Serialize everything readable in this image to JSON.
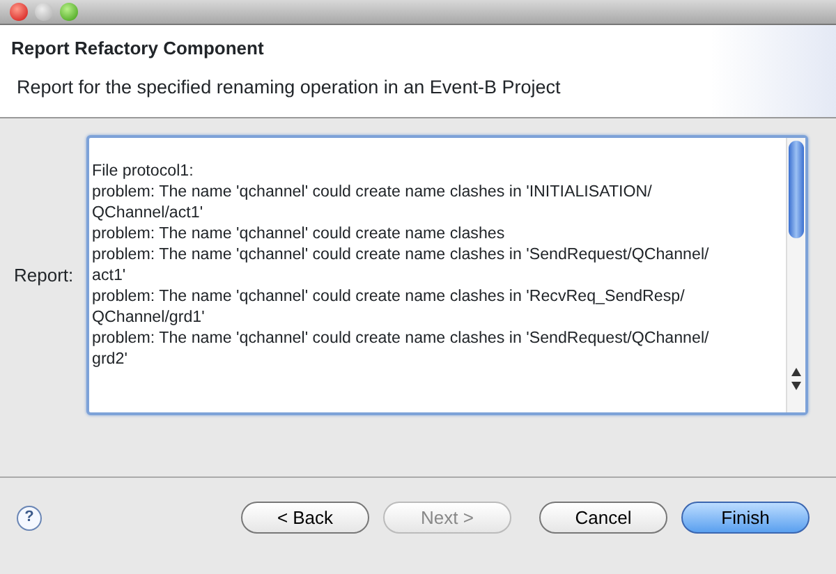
{
  "window": {
    "title_buttons": [
      {
        "kind": "close"
      },
      {
        "kind": "minimize"
      },
      {
        "kind": "zoom"
      }
    ]
  },
  "header": {
    "title": "Report Refactory Component",
    "description": "Report for the specified renaming operation in an Event-B Project"
  },
  "report": {
    "label": "Report:",
    "lines": [
      "File protocol1:",
      "problem: The name 'qchannel' could create name clashes in 'INITIALISATION/",
      "QChannel/act1'",
      "problem: The name 'qchannel' could create name clashes",
      "problem: The name 'qchannel' could create name clashes in 'SendRequest/QChannel/",
      "act1'",
      "problem: The name 'qchannel' could create name clashes in 'RecvReq_SendResp/",
      "QChannel/grd1'",
      "problem: The name 'qchannel' could create name clashes in 'SendRequest/QChannel/",
      "grd2'"
    ]
  },
  "help": "?",
  "buttons": [
    {
      "label": "< Back",
      "disabled": false,
      "default": false
    },
    {
      "label": "Next >",
      "disabled": true,
      "default": false
    },
    {
      "label": "Cancel",
      "disabled": false,
      "default": false
    },
    {
      "label": "Finish",
      "disabled": false,
      "default": true
    }
  ]
}
